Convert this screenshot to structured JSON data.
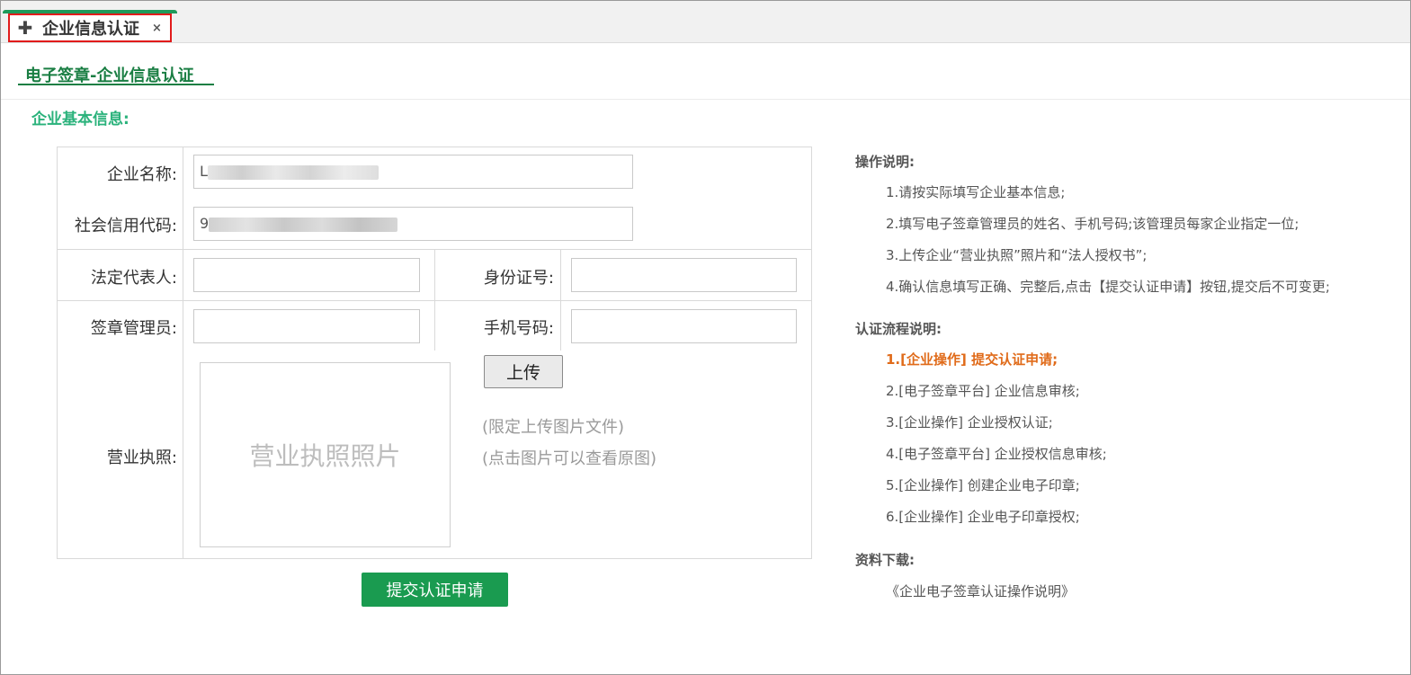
{
  "tab": {
    "icon": "plus-icon",
    "title": "企业信息认证",
    "close": "×"
  },
  "page_title": "电子签章-企业信息认证",
  "section_title": "企业基本信息:",
  "form": {
    "company_name_label": "企业名称:",
    "company_name_value": "L",
    "credit_code_label": "社会信用代码:",
    "credit_code_value": "9",
    "legal_rep_label": "法定代表人:",
    "id_number_label": "身份证号:",
    "seal_admin_label": "签章管理员:",
    "phone_label": "手机号码:",
    "license_label": "营业执照:",
    "license_placeholder": "营业执照照片",
    "upload_label": "上传",
    "hint1": "(限定上传图片文件)",
    "hint2": "(点击图片可以查看原图)",
    "submit_label": "提交认证申请"
  },
  "side": {
    "instructions_title": "操作说明:",
    "instructions": [
      "1.请按实际填写企业基本信息;",
      "2.填写电子签章管理员的姓名、手机号码;该管理员每家企业指定一位;",
      "3.上传企业“营业执照”照片和“法人授权书”;",
      "4.确认信息填写正确、完整后,点击【提交认证申请】按钮,提交后不可变更;"
    ],
    "process_title": "认证流程说明:",
    "process": [
      "1.[企业操作] 提交认证申请;",
      "2.[电子签章平台] 企业信息审核;",
      "3.[企业操作] 企业授权认证;",
      "4.[电子签章平台] 企业授权信息审核;",
      "5.[企业操作] 创建企业电子印章;",
      "6.[企业操作] 企业电子印章授权;"
    ],
    "download_title": "资料下载:",
    "download_link": "《企业电子签章认证操作说明》"
  },
  "colors": {
    "accent": "#1a9b50",
    "title_green": "#1a7e43",
    "active_step": "#e06b1a",
    "tab_border": "#e11b1b"
  }
}
